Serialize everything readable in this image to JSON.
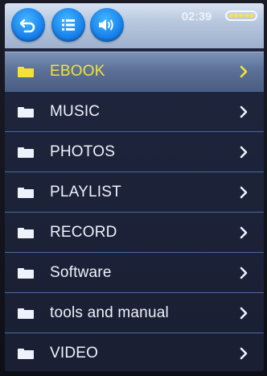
{
  "status_bar": {
    "time": "02:39",
    "battery_level_fraction": 1.0,
    "buttons": [
      {
        "name": "back-button",
        "icon": "back-arrow-icon"
      },
      {
        "name": "list-button",
        "icon": "list-icon"
      },
      {
        "name": "volume-button",
        "icon": "speaker-icon"
      }
    ]
  },
  "menu": {
    "selected_index": 0,
    "items": [
      {
        "label": "EBOOK",
        "icon": "folder-icon"
      },
      {
        "label": "MUSIC",
        "icon": "folder-icon"
      },
      {
        "label": "PHOTOS",
        "icon": "folder-icon"
      },
      {
        "label": "PLAYLIST",
        "icon": "folder-icon"
      },
      {
        "label": "RECORD",
        "icon": "folder-icon"
      },
      {
        "label": "Software",
        "icon": "folder-icon"
      },
      {
        "label": "tools and manual",
        "icon": "folder-icon"
      },
      {
        "label": "VIDEO",
        "icon": "folder-icon"
      }
    ]
  },
  "colors": {
    "selected_text": "#f4e23a",
    "normal_text": "#eef2fb",
    "button_blue": "#1a86ee",
    "battery_cell": "#ffe23b"
  }
}
